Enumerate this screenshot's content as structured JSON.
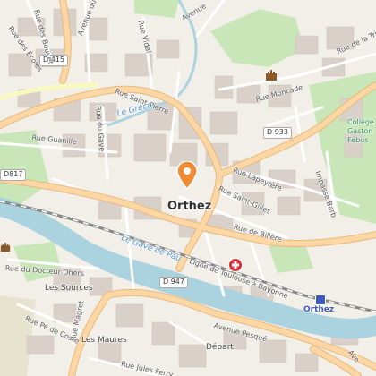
{
  "map": {
    "city_name": "Orthez",
    "road_shields": [
      "D 415",
      "D 933",
      "D 947",
      "D817"
    ],
    "streets": {
      "corps_franc": "Avenue du Corps Franc",
      "ecoles": "Rue des Écoles",
      "bouvet": "Rue des Bouvet",
      "vidal": "Rue Vidal",
      "avenue_top": "Avenue",
      "saint_pierre": "Rue Saint-Pierre",
      "gave": "Rue du Gave",
      "guanille": "Rue Guanille",
      "moncade": "Rue Moncade",
      "trinite": "Rue de la Trinité",
      "lapeyrere": "Rue Lapeyrère",
      "saint_gilles": "Rue Saint-Gilles",
      "billere": "Rue de Billère",
      "impasse": "Impasse Barb",
      "docteur_dhers": "Rue du Docteur Dhers",
      "pe_de_coste": "Rue Pé de Coste",
      "pesque": "Avenue Pesqué",
      "jules_ferry": "Rue Jules Ferry",
      "rue_bottom_right": "Ave",
      "magret": "Rue Magret"
    },
    "water": {
      "gave": "Le Gave de Pau",
      "greco": "Le Gréca"
    },
    "railway": "Ligne de Toulouse à Bayonne",
    "places": {
      "sources": "Les Sources",
      "maures": "Les Maures",
      "depart": "Départ",
      "college": "Collège Gaston Fébus",
      "station": "Orthez"
    },
    "icons": [
      "location-pin-icon",
      "hospital-icon",
      "castle-icon",
      "train-station-icon"
    ],
    "colors": {
      "land": "#f2efe9",
      "building": "#d9d0c9",
      "water": "#aad3df",
      "park": "#c8e6b8",
      "major_road": "#fcd6a4",
      "pin": "#f08a35",
      "hospital": "#d9303a"
    }
  }
}
